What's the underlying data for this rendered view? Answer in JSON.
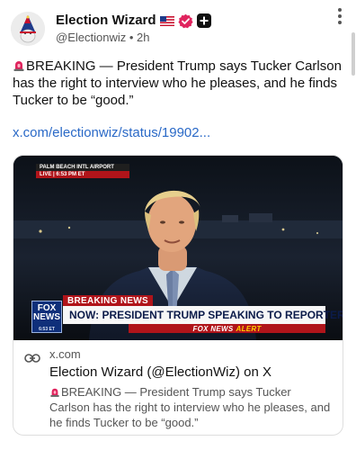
{
  "post": {
    "display_name": "Election Wizard",
    "handle": "@Electionwiz",
    "separator": "•",
    "time": "2h",
    "body": "BREAKING — President Trump says Tucker Carlson has the right to interview who he pleases, and he finds Tucker to be “good.”",
    "link_text": "x.com/electionwiz/status/19902..."
  },
  "card": {
    "domain": "x.com",
    "title": "Election Wizard (@ElectionWiz) on X",
    "description": "BREAKING — President Trump says Tucker Carlson has the right to interview who he pleases, and he finds Tucker to be “good.”"
  },
  "broadcast": {
    "location": "PALM BEACH INTL AIRPORT",
    "live": "LIVE",
    "live_time": "6:53 PM ET",
    "breaking_label": "BREAKING NEWS",
    "headline": "NOW: PRESIDENT TRUMP SPEAKING TO REPORTERS",
    "network": "FOX NEWS",
    "alert": "ALERT",
    "logo_top": "FOX",
    "logo_bottom": "NEWS",
    "logo_time": "6:53 ET"
  },
  "colors": {
    "link": "#2a69c7",
    "verified": "#e0245e",
    "chyron_red": "#b0141a",
    "fox_blue": "#0f2f7a"
  },
  "icons": {
    "avatar": "wizard-avatar",
    "flag": "us-flag-icon",
    "verified": "verified-badge-icon",
    "plus": "plus-badge-icon",
    "more": "more-vertical-icon",
    "siren": "siren-icon",
    "link": "link-icon"
  }
}
